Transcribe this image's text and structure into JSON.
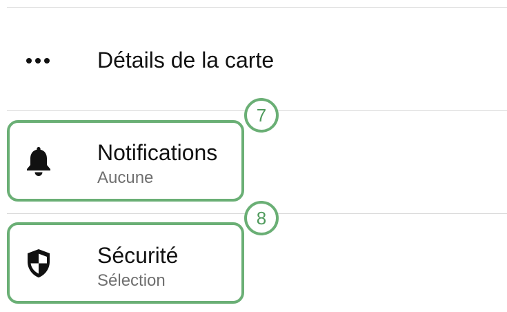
{
  "rows": [
    {
      "title": "Détails de la carte",
      "icon": "more-horizontal-icon"
    },
    {
      "title": "Notifications",
      "subtitle": "Aucune",
      "icon": "bell-icon"
    },
    {
      "title": "Sécurité",
      "subtitle": "Sélection",
      "icon": "shield-icon"
    }
  ],
  "badges": [
    "7",
    "8"
  ],
  "colors": {
    "highlight": "#6aaf75",
    "badge_text": "#4f9a5c",
    "subtitle": "#6f6f6f",
    "divider": "#d9d9d9"
  }
}
